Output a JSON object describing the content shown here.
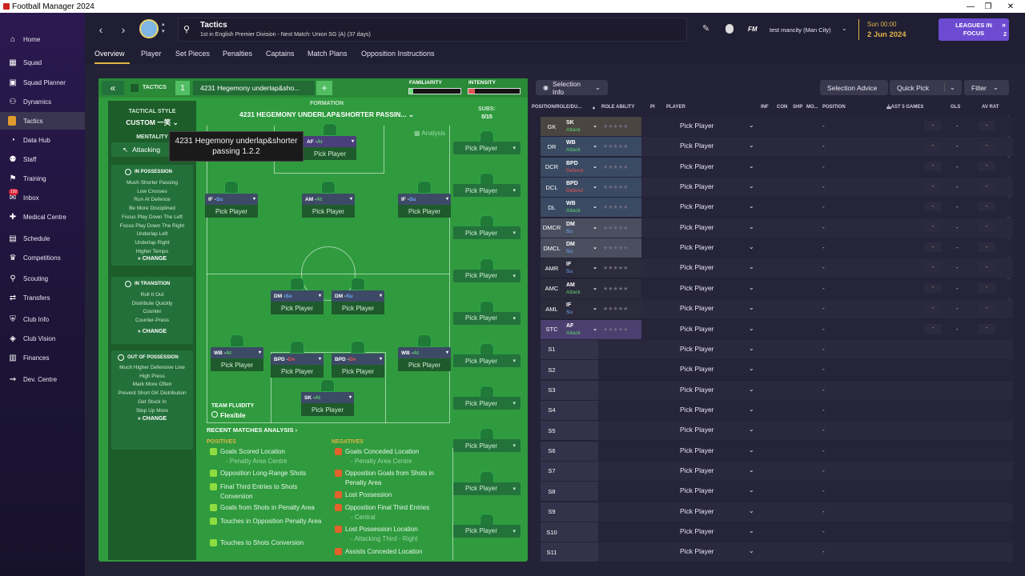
{
  "window": {
    "title": "Football Manager 2024",
    "controls": [
      "—",
      "❐",
      "✕"
    ]
  },
  "sidebar": {
    "items": [
      {
        "label": "Home",
        "icon": "home-icon"
      },
      {
        "label": "Squad",
        "icon": "squad-icon"
      },
      {
        "label": "Squad Planner",
        "icon": "squad-planner-icon"
      },
      {
        "label": "Dynamics",
        "icon": "dynamics-icon"
      },
      {
        "label": "Tactics",
        "icon": "tactics-icon"
      },
      {
        "label": "Data Hub",
        "icon": "data-hub-icon"
      },
      {
        "label": "Staff",
        "icon": "staff-icon"
      },
      {
        "label": "Training",
        "icon": "training-icon"
      },
      {
        "label": "Inbox",
        "icon": "inbox-icon",
        "badge": "150"
      },
      {
        "label": "Medical Centre",
        "icon": "medical-icon"
      },
      {
        "label": "Schedule",
        "icon": "schedule-icon"
      },
      {
        "label": "Competitions",
        "icon": "trophy-icon"
      },
      {
        "label": "Scouting",
        "icon": "scouting-icon"
      },
      {
        "label": "Transfers",
        "icon": "transfers-icon"
      },
      {
        "label": "Club Info",
        "icon": "shield-icon"
      },
      {
        "label": "Club Vision",
        "icon": "vision-icon"
      },
      {
        "label": "Finances",
        "icon": "finances-icon"
      },
      {
        "label": "Dev. Centre",
        "icon": "dev-centre-icon"
      }
    ],
    "active": "Tactics"
  },
  "header": {
    "title": "Tactics",
    "subtitle": "1st in English Premier Division - Next Match: Union SG (A) (37 days)",
    "manager": "test mancity (Man City)",
    "fm": "FM",
    "time": "Sun 00:00",
    "date": "2 Jun 2024",
    "leagues_btn": "LEAGUES IN FOCUS",
    "leagues_count": "2"
  },
  "tabs": [
    "Overview",
    "Player",
    "Set Pieces",
    "Penalties",
    "Captains",
    "Match Plans",
    "Opposition Instructions"
  ],
  "tactics": {
    "label": "TACTICS",
    "slot": "1",
    "name": "4231 Hegemony underlap&sho...",
    "add": "+",
    "familiarity": "FAMILIARITY",
    "intensity": "INTENSITY",
    "style_label": "TACTICAL STYLE",
    "style": "CUSTOM 一笑",
    "mentality_label": "MENTALITY",
    "mentality": "Attacking",
    "formation_label": "FORMATION",
    "formation": "4231 HEGEMONY UNDERLAP&SHORTER PASSIN...",
    "subs_label": "SUBS:",
    "subs": "0/15",
    "tooltip": "4231 Hegemony underlap&shorter passing 1.2.2",
    "analysis": "Analysis",
    "fluidity_label": "TEAM FLUIDITY",
    "fluidity": "Flexible",
    "in_possession": {
      "title": "IN POSSESSION",
      "items": [
        "Much Shorter Passing",
        "Low Crosses",
        "Run At Defence",
        "Be More Disciplined",
        "Focus Play Down The Left",
        "Focus Play Down The Right",
        "Underlap Left",
        "Underlap Right",
        "Higher Tempo"
      ]
    },
    "in_transition": {
      "title": "IN TRANSITION",
      "items": [
        "Roll It Out",
        "Distribute Quickly",
        "Counter",
        "Counter-Press"
      ]
    },
    "out_possession": {
      "title": "OUT OF POSSESSION",
      "items": [
        "Much Higher Defensive Line",
        "High Press",
        "Mark More Often",
        "Prevent Short GK Distribution",
        "Get Stuck In",
        "Step Up More"
      ]
    },
    "change": "CHANGE",
    "pick": "Pick Player",
    "pitch_roles": [
      {
        "role": "AF",
        "duty": "At"
      },
      {
        "role": "IF",
        "duty": "Su"
      },
      {
        "role": "AM",
        "duty": "At"
      },
      {
        "role": "IF",
        "duty": "Su"
      },
      {
        "role": "DM",
        "duty": "Su"
      },
      {
        "role": "DM",
        "duty": "Su"
      },
      {
        "role": "WB",
        "duty": "At"
      },
      {
        "role": "BPD",
        "duty": "De"
      },
      {
        "role": "BPD",
        "duty": "De"
      },
      {
        "role": "WB",
        "duty": "At"
      },
      {
        "role": "SK",
        "duty": "At"
      }
    ],
    "recent": "RECENT MATCHES ANALYSIS",
    "positives_label": "POSITIVES",
    "negatives_label": "NEGATIVES",
    "positives": [
      [
        "Goals Scored Location",
        "- Penalty Area Centre"
      ],
      [
        "Opposition Long-Range Shots",
        ""
      ],
      [
        "Final Third Entries to Shots Conversion",
        ""
      ],
      [
        "Goals from Shots in Penalty Area",
        ""
      ],
      [
        "Touches in Opposition Penalty Area",
        ""
      ],
      [
        "Touches to Shots Conversion",
        ""
      ]
    ],
    "negatives": [
      [
        "Goals Conceded Location",
        "- Penalty Area Centre"
      ],
      [
        "Opposition Goals from Shots in Penalty Area",
        ""
      ],
      [
        "Lost Possession",
        ""
      ],
      [
        "Opposition Final Third Entries",
        "- Central"
      ],
      [
        "Lost Possession Location",
        "- Attacking Third - Right"
      ],
      [
        "Assists Conceded Location",
        ""
      ]
    ]
  },
  "right": {
    "selection_info": "Selection Info",
    "selection_advice": "Selection Advice",
    "quick_pick": "Quick Pick",
    "filter": "Filter",
    "columns": [
      "POSITION/ROLE/DU...",
      "ROLE ABILITY",
      "PI",
      "PLAYER",
      "INF",
      "CON",
      "SHP",
      "MO...",
      "POSITION",
      "LAST 5 GAMES",
      "GLS",
      "AV RAT"
    ],
    "rows": [
      {
        "pos": "GK",
        "role": "SK",
        "duty": "Attack"
      },
      {
        "pos": "DR",
        "role": "WB",
        "duty": "Attack"
      },
      {
        "pos": "DCR",
        "role": "BPD",
        "duty": "Defend"
      },
      {
        "pos": "DCL",
        "role": "BPD",
        "duty": "Defend"
      },
      {
        "pos": "DL",
        "role": "WB",
        "duty": "Attack"
      },
      {
        "pos": "DMCR",
        "role": "DM",
        "duty": "Su"
      },
      {
        "pos": "DMCL",
        "role": "DM",
        "duty": "Su"
      },
      {
        "pos": "AMR",
        "role": "IF",
        "duty": "Su"
      },
      {
        "pos": "AMC",
        "role": "AM",
        "duty": "Attack"
      },
      {
        "pos": "AML",
        "role": "IF",
        "duty": "Su"
      },
      {
        "pos": "STC",
        "role": "AF",
        "duty": "Attack"
      },
      {
        "pos": "S1"
      },
      {
        "pos": "S2"
      },
      {
        "pos": "S3"
      },
      {
        "pos": "S4"
      },
      {
        "pos": "S5"
      },
      {
        "pos": "S6"
      },
      {
        "pos": "S7"
      },
      {
        "pos": "S8"
      },
      {
        "pos": "S9"
      },
      {
        "pos": "S10"
      },
      {
        "pos": "S11"
      }
    ],
    "pick": "Pick Player",
    "dash": "-"
  },
  "colors": {
    "pitch": "#2f9b3e",
    "accent": "#6c4bd1",
    "date": "#e0b447",
    "attack": "#5fd06e",
    "defend": "#e25555",
    "support": "#6fa8ff"
  }
}
